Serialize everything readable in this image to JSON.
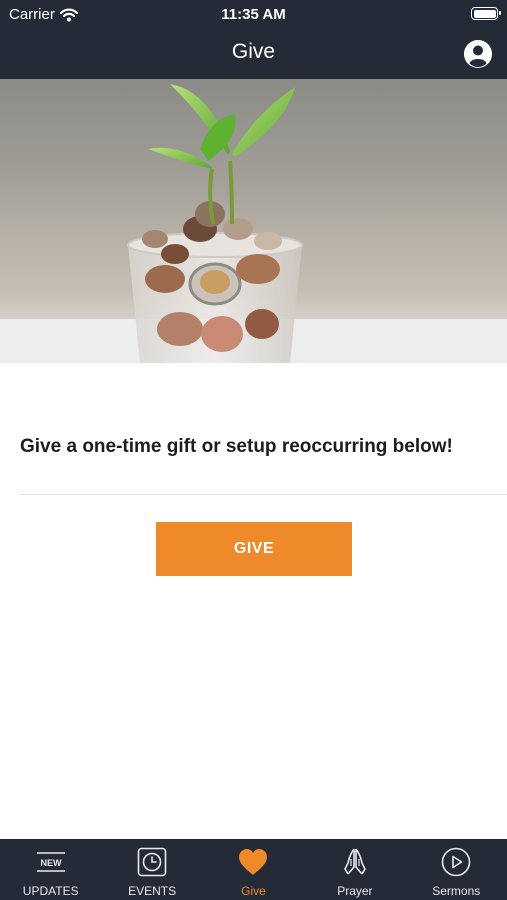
{
  "status_bar": {
    "carrier": "Carrier",
    "time": "11:35 AM"
  },
  "nav": {
    "title": "Give",
    "profile_icon": "person-icon"
  },
  "hero": {
    "image": "plant-sprouting-from-coins-in-glass"
  },
  "content": {
    "headline": "Give a one-time gift or setup reoccurring below!",
    "give_button": "GIVE"
  },
  "tabs": [
    {
      "label": "UPDATES",
      "icon": "new-badge-icon",
      "badge_text": "NEW",
      "active": false
    },
    {
      "label": "EVENTS",
      "icon": "clock-icon",
      "active": false
    },
    {
      "label": "Give",
      "icon": "heart-icon",
      "active": true
    },
    {
      "label": "Prayer",
      "icon": "praying-hands-icon",
      "active": false
    },
    {
      "label": "Sermons",
      "icon": "play-circle-icon",
      "active": false
    }
  ],
  "colors": {
    "bar_background": "#252a37",
    "accent": "#ef8a2b",
    "tab_text": "#e9e9ee"
  }
}
